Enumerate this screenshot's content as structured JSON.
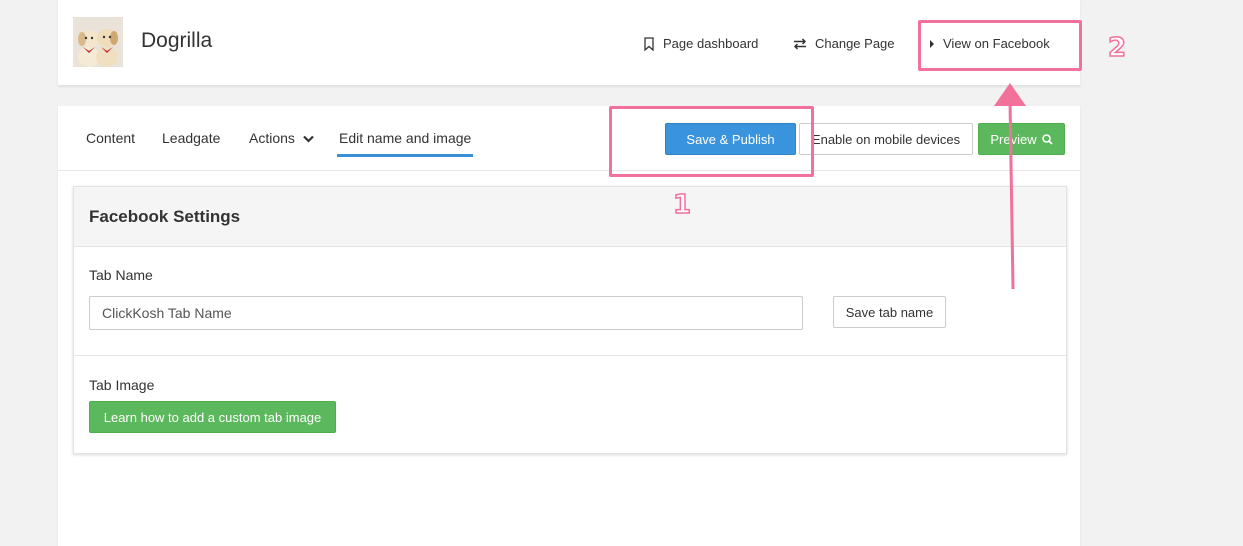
{
  "header": {
    "page_name": "Dogrilla",
    "links": {
      "dashboard": {
        "label": "Page dashboard",
        "icon": "bookmark-icon"
      },
      "change_page": {
        "label": "Change Page",
        "icon": "swap-arrows-icon"
      },
      "view_facebook": {
        "label": "View on Facebook",
        "icon": "caret-right-icon"
      }
    }
  },
  "tabs": [
    {
      "label": "Content"
    },
    {
      "label": "Leadgate"
    },
    {
      "label": "Actions"
    },
    {
      "label": "Edit name and image",
      "active": true
    }
  ],
  "toolbar": {
    "save_publish": "Save & Publish",
    "enable_mobile": "Enable on mobile devices",
    "preview": "Preview"
  },
  "facebook_settings": {
    "title": "Facebook Settings",
    "tab_name_label": "Tab Name",
    "tab_name_value": "ClickKosh Tab Name",
    "save_tab_name": "Save tab name",
    "tab_image_label": "Tab Image",
    "learn_button": "Learn how to add a custom tab image"
  },
  "annotations": {
    "one": "1",
    "two": "2",
    "color": "#f2719a"
  },
  "colors": {
    "primary_blue": "#3a94dd",
    "success_green": "#5cb85c",
    "tab_underline": "#3a8fd9"
  }
}
